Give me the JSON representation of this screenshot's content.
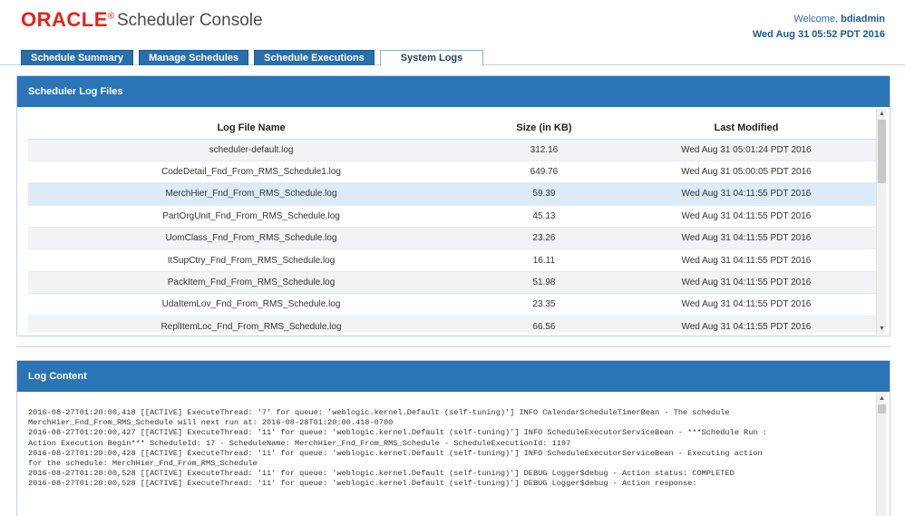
{
  "header": {
    "brand": "ORACLE",
    "app_title": "Scheduler Console",
    "welcome_prefix": "Welcome,",
    "username": "bdiadmin",
    "datetime": "Wed Aug 31 05:52 PDT 2016"
  },
  "tabs": [
    {
      "label": "Schedule Summary",
      "active": false
    },
    {
      "label": "Manage Schedules",
      "active": false
    },
    {
      "label": "Schedule Executions",
      "active": false
    },
    {
      "label": "System Logs",
      "active": true
    }
  ],
  "log_files_panel": {
    "title": "Scheduler Log Files",
    "columns": [
      "Log File Name",
      "Size (in KB)",
      "Last Modified"
    ],
    "rows": [
      {
        "name": "scheduler-default.log",
        "size": "312.16",
        "modified": "Wed Aug 31 05:01:24 PDT 2016"
      },
      {
        "name": "CodeDetail_Fnd_From_RMS_Schedule1.log",
        "size": "649.76",
        "modified": "Wed Aug 31 05:00:05 PDT 2016"
      },
      {
        "name": "MerchHier_Fnd_From_RMS_Schedule.log",
        "size": "59.39",
        "modified": "Wed Aug 31 04:11:55 PDT 2016"
      },
      {
        "name": "PartOrgUnit_Fnd_From_RMS_Schedule.log",
        "size": "45.13",
        "modified": "Wed Aug 31 04:11:55 PDT 2016"
      },
      {
        "name": "UomClass_Fnd_From_RMS_Schedule.log",
        "size": "23.26",
        "modified": "Wed Aug 31 04:11:55 PDT 2016"
      },
      {
        "name": "ItSupCtry_Fnd_From_RMS_Schedule.log",
        "size": "16.11",
        "modified": "Wed Aug 31 04:11:55 PDT 2016"
      },
      {
        "name": "PackItem_Fnd_From_RMS_Schedule.log",
        "size": "51.98",
        "modified": "Wed Aug 31 04:11:55 PDT 2016"
      },
      {
        "name": "UdaItemLov_Fnd_From_RMS_Schedule.log",
        "size": "23.35",
        "modified": "Wed Aug 31 04:11:55 PDT 2016"
      },
      {
        "name": "ReplItemLoc_Fnd_From_RMS_Schedule.log",
        "size": "66.56",
        "modified": "Wed Aug 31 04:11:55 PDT 2016"
      }
    ],
    "selected_row": 2
  },
  "log_content_panel": {
    "title": "Log Content",
    "lines": [
      "2016-08-27T01:20:00,418 [[ACTIVE] ExecuteThread: '7' for queue: 'weblogic.kernel.Default (self-tuning)'] INFO CalendarScheduleTimerBean - The schedule",
      "MerchHier_Fnd_From_RMS_Schedule will next run at: 2016-08-28T01:20:00.418-0700",
      "2016-08-27T01:20:00,427 [[ACTIVE] ExecuteThread: '11' for queue: 'weblogic.kernel.Default (self-tuning)'] INFO ScheduleExecutorServiceBean - ***Schedule Run :",
      "Action Execution Begin*** ScheduleId: 17 - ScheduleName: MerchHier_Fnd_From_RMS_Schedule - ScheduleExecutionId: 1197",
      "2016-08-27T01:20:00,428 [[ACTIVE] ExecuteThread: '11' for queue: 'weblogic.kernel.Default (self-tuning)'] INFO ScheduleExecutorServiceBean - Executing action",
      "for the schedule: MerchHier_Fnd_From_RMS_Schedule",
      "2016-08-27T01:20:00,528 [[ACTIVE] ExecuteThread: '11' for queue: 'weblogic.kernel.Default (self-tuning)'] DEBUG Logger$debug - Action status: COMPLETED",
      "2016-08-27T01:20:00,528 [[ACTIVE] ExecuteThread: '11' for queue: 'weblogic.kernel.Default (self-tuning)'] DEBUG Logger$debug - Action response:"
    ]
  },
  "colors": {
    "brand_red": "#e2231a",
    "panel_header_blue": "#2b74b5",
    "tab_blue": "#2a6fa8",
    "selected_row": "#dcebf8"
  },
  "icons": [
    "scroll-up-icon",
    "scroll-down-icon"
  ]
}
